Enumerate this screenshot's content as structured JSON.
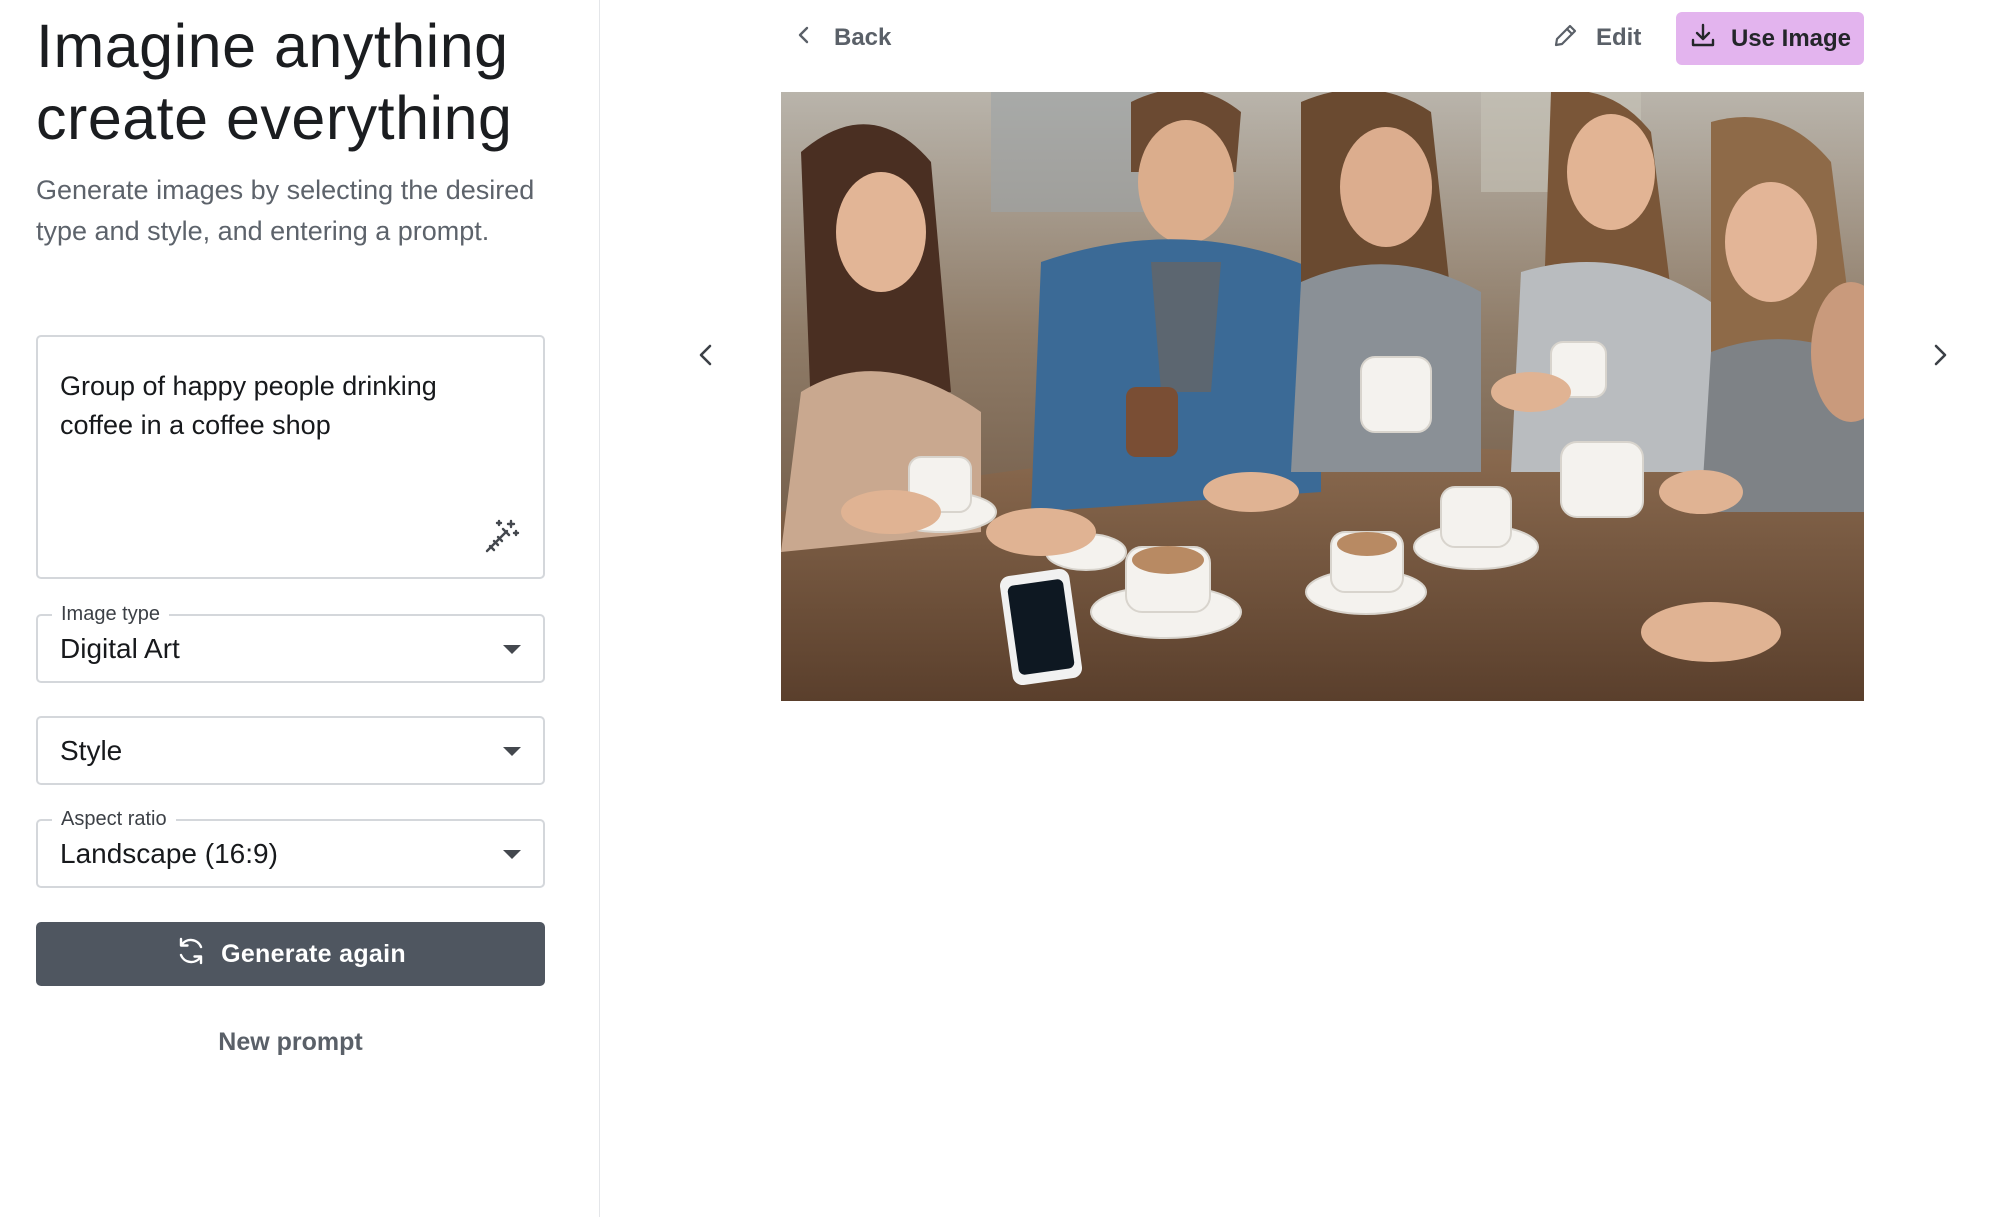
{
  "left_panel": {
    "title_line1": "Imagine anything",
    "title_line2": "create everything",
    "subtitle": "Generate images by selecting the desired type and style, and entering a prompt.",
    "prompt": {
      "value": "Group of happy people drinking coffee in a coffee shop",
      "enhance_icon": "magic-wand-icon"
    },
    "image_type": {
      "label": "Image type",
      "value": "Digital Art"
    },
    "style": {
      "placeholder": "Style"
    },
    "aspect_ratio": {
      "label": "Aspect ratio",
      "value": "Landscape (16:9)"
    },
    "generate_button": {
      "label": "Generate again",
      "icon": "refresh-icon"
    },
    "new_prompt_label": "New prompt"
  },
  "toolbar": {
    "back_label": "Back",
    "edit_label": "Edit",
    "use_image_label": "Use Image",
    "use_image_color": "#e3b4ee"
  },
  "preview": {
    "alt": "Group of happy people drinking coffee in a coffee shop"
  },
  "colors": {
    "primary_button": "#4f5660",
    "accent": "#e3b4ee",
    "border": "#d4d7db"
  }
}
